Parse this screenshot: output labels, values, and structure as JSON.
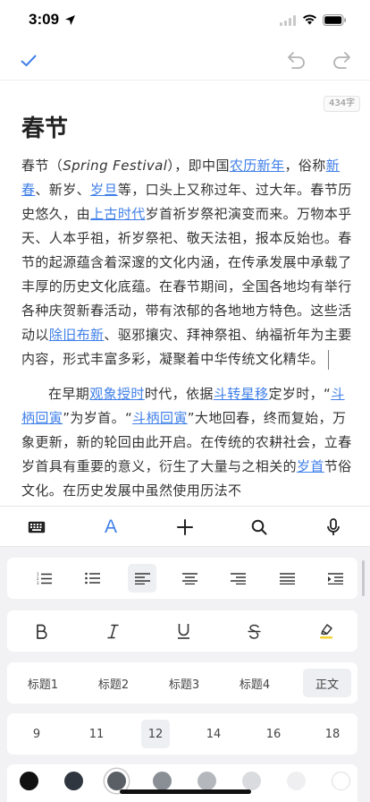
{
  "status_bar": {
    "time": "3:09"
  },
  "editor": {
    "word_count": "434字",
    "title": "春节",
    "para1": {
      "s01": "春节（",
      "s02": "Spring Festival",
      "s03": "），即中国",
      "s04": "农历新年",
      "s05": "，俗称",
      "s06": "新春",
      "s07": "、新岁、",
      "s08": "岁旦",
      "s09": "等，口头上又称过年、过大年。春节历史悠久，由",
      "s10": "上古时代",
      "s11": "岁首祈岁祭祀演变而来。万物本乎天、人本乎祖，祈岁祭祀、敬天法祖，报本反始也。春节的起源蕴含着深邃的文化内涵，在传承发展中承载了丰厚的历史文化底蕴。在春节期间，全国各地均有举行各种庆贺新春活动，带有浓郁的各地地方特色。这些活动以",
      "s12": "除旧布新",
      "s13": "、驱邪攘灾、拜神祭祖、纳福祈年为主要内容，形式丰富多彩，凝聚着中华传统文化精华。"
    },
    "para2": {
      "s01": "在早期",
      "s02": "观象授时",
      "s03": "时代，依据",
      "s04": "斗转星移",
      "s05": "定岁时，“",
      "s06": "斗柄回寅",
      "s07": "”为岁首。“",
      "s08": "斗柄回寅",
      "s09": "”大地回春，终而复始，万象更新，新的轮回由此开启。在传统的农耕社会，立春岁首具有重要的意义，衍生了大量与之相关的",
      "s10": "岁首",
      "s11": "节俗文化。在历史发展中虽然使用历法不"
    }
  },
  "bottom_toolbar": {
    "format_label": "A",
    "accent": "#3f7fe8"
  },
  "format_panel": {
    "headings": [
      "标题1",
      "标题2",
      "标题3",
      "标题4",
      "正文"
    ],
    "selected_heading": "正文",
    "font_sizes": [
      "9",
      "11",
      "12",
      "14",
      "16",
      "18"
    ],
    "selected_size": "12",
    "selected_alignment": "align-left",
    "text_colors": [
      "#111111",
      "#2f3640",
      "#5a5f66",
      "#8a8f96",
      "#b4b8bd",
      "#d9dbde",
      "#efeff1",
      "#ffffff"
    ],
    "selected_color": "#5a5f66",
    "highlight_color": "#f5d22e"
  }
}
